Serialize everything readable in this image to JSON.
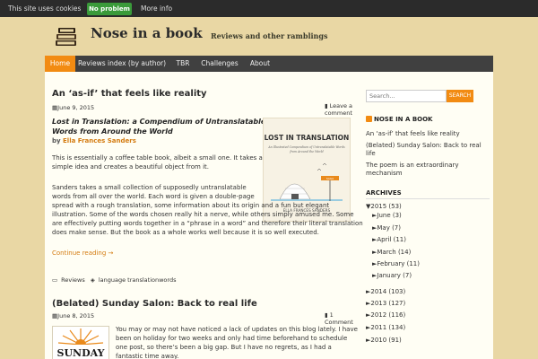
{
  "cookie": {
    "message": "This site uses cookies",
    "ok": "No problem",
    "more": "More info"
  },
  "site": {
    "title": "Nose in a book",
    "tagline": "Reviews and other ramblings"
  },
  "nav": [
    "Home",
    "Reviews index (by author)",
    "TBR",
    "Challenges",
    "About"
  ],
  "posts": [
    {
      "title": "An ‘as-if’ that feels like reality",
      "date": "June 9, 2015",
      "comments": [
        "Leave a",
        "comment"
      ],
      "book_title": [
        "Lost in Translation: a Compendium of Untranslatable",
        "Words from Around the World"
      ],
      "author_prefix": "by",
      "author": "Ella Frances Sanders",
      "cover_title": "LOST IN TRANSLATION",
      "cover_sub1": "An Illustrated Compendium of Untranslatable Words",
      "cover_sub2": "from Around the World",
      "cover_author": "ELLA FRANCES SANDERS",
      "cover_sign": "SAGA",
      "paragraphs": [
        [
          "This is essentially a coffee table book, albeit a small one. It takes a",
          "simple idea and creates a beautiful object from it."
        ],
        [
          "Sanders takes a small collection of supposedly untranslatable",
          "words from all over the world. Each word is given a double-page",
          "spread with a rough translation, some information about its origin and a fun but elegant",
          "illustration. Some of the words chosen really hit a nerve, while others simply amused me. Some",
          "are effectively putting words together in a “phrase in a word” and therefore their literal translation",
          "does make sense. But the book as a whole works well because it is so well executed."
        ]
      ],
      "more": "Continue reading →",
      "categories": "Reviews",
      "tags": "language translationwords"
    },
    {
      "title": "(Belated) Sunday Salon: Back to real life",
      "date": "June 8, 2015",
      "comments": [
        "1",
        "Comment"
      ],
      "cover_text": "SUNDAY",
      "lines": [
        "You may or may not have noticed a lack of updates on this blog lately. I have",
        "been on holiday for two weeks and only had time beforehand to schedule",
        "one post, so there’s been a big gap. But I have no regrets, as I had a",
        "fantastic time away."
      ]
    }
  ],
  "sidebar": {
    "search_placeholder": "Search...",
    "search_button": "SEARCH",
    "feed_title": "NOSE IN A BOOK",
    "feed_items": [
      [
        "An ‘as-if’ that feels like reality"
      ],
      [
        "(Belated) Sunday Salon: Back to real",
        "life"
      ],
      [
        "The poem is an extraordinary",
        "mechanism"
      ]
    ],
    "archives_title": "ARCHIVES",
    "year_open": "▼2015 (53)",
    "months": [
      "►June (3)",
      "►May (7)",
      "►April (11)",
      "►March (14)",
      "►February (11)",
      "►January (7)"
    ],
    "years": [
      "►2014 (103)",
      "►2013 (127)",
      "►2012 (116)",
      "►2011 (134)",
      "►2010 (91)"
    ]
  }
}
